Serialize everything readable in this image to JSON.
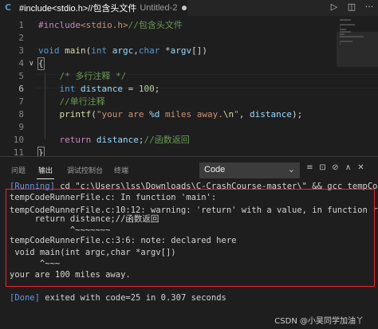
{
  "colors": {
    "background": "#1e1e1e",
    "keyword": "#569cd6",
    "string": "#ce9178",
    "comment": "#6a9955",
    "function": "#dcdcaa",
    "number": "#b5cea8",
    "running_tag": "#6796e6",
    "highlight_box": "#e8262b"
  },
  "tab": {
    "icon": "C",
    "icon_name": "c-language-icon",
    "title": "#include<stdio.h>//包含头文件",
    "subtitle": "Untitled-2",
    "dirty_indicator": "unsaved-dot-icon"
  },
  "editor_actions": [
    {
      "icon": "run-icon",
      "glyph": "▷"
    },
    {
      "icon": "split-editor-icon",
      "glyph": "◫"
    },
    {
      "icon": "more-icon",
      "glyph": "···"
    }
  ],
  "editor": {
    "lines": [
      {
        "n": "1",
        "tokens": [
          [
            "pp",
            "#include"
          ],
          [
            "str",
            "<stdio.h>"
          ],
          [
            "cmt",
            "//包含头文件"
          ]
        ]
      },
      {
        "n": "2",
        "tokens": []
      },
      {
        "n": "3",
        "tokens": [
          [
            "kw",
            "void"
          ],
          [
            "txt",
            " "
          ],
          [
            "fn",
            "main"
          ],
          [
            "txt",
            "("
          ],
          [
            "kw",
            "int"
          ],
          [
            "txt",
            " "
          ],
          [
            "var",
            "argc"
          ],
          [
            "txt",
            ","
          ],
          [
            "kw",
            "char"
          ],
          [
            "txt",
            " *"
          ],
          [
            "var",
            "argv"
          ],
          [
            "txt",
            "[])"
          ]
        ]
      },
      {
        "n": "4",
        "tokens": [
          [
            "txt",
            "{"
          ]
        ]
      },
      {
        "n": "5",
        "tokens": [
          [
            "cmt",
            "    /* 多行注释 */"
          ]
        ]
      },
      {
        "n": "6",
        "tokens": [
          [
            "txt",
            "    "
          ],
          [
            "kw",
            "int"
          ],
          [
            "txt",
            " "
          ],
          [
            "var",
            "distance"
          ],
          [
            "txt",
            " = "
          ],
          [
            "num",
            "100"
          ],
          [
            "txt",
            ";"
          ]
        ]
      },
      {
        "n": "7",
        "tokens": [
          [
            "cmt",
            "    //单行注释"
          ]
        ]
      },
      {
        "n": "8",
        "tokens": [
          [
            "txt",
            "    "
          ],
          [
            "fn",
            "printf"
          ],
          [
            "txt",
            "("
          ],
          [
            "str",
            "\"your are "
          ],
          [
            "var",
            "%d"
          ],
          [
            "str",
            " miles away."
          ],
          [
            "fn",
            "\\n"
          ],
          [
            "str",
            "\""
          ],
          [
            "txt",
            ", "
          ],
          [
            "var",
            "distance"
          ],
          [
            "txt",
            ");"
          ]
        ]
      },
      {
        "n": "9",
        "tokens": []
      },
      {
        "n": "10",
        "tokens": [
          [
            "txt",
            "    "
          ],
          [
            "pp",
            "return"
          ],
          [
            "txt",
            " "
          ],
          [
            "var",
            "distance"
          ],
          [
            "txt",
            ";"
          ],
          [
            "cmt",
            "//函数返回"
          ]
        ]
      },
      {
        "n": "11",
        "tokens": [
          [
            "txt",
            "}"
          ]
        ]
      }
    ],
    "active_line": "6"
  },
  "panel": {
    "tabs": [
      "问题",
      "输出",
      "调试控制台",
      "终端"
    ],
    "active_tab": "输出",
    "dropdown_value": "Code",
    "actions": [
      {
        "icon": "list-filter-icon",
        "glyph": "≡"
      },
      {
        "icon": "lock-icon",
        "glyph": "⊡"
      },
      {
        "icon": "clear-output-icon",
        "glyph": "⊘"
      },
      {
        "icon": "chevron-up-icon",
        "glyph": "∧"
      },
      {
        "icon": "close-icon",
        "glyph": "✕"
      }
    ]
  },
  "output": {
    "running_tag": "[Running]",
    "command": " cd \"c:\\Users\\lss\\Downloads\\C-CrashCourse-master\\\" && gcc tempCodeRunner",
    "lines": [
      "tempCodeRunnerFile.c: In function 'main':",
      "tempCodeRunnerFile.c:10:12: warning: 'return' with a value, in function returnin",
      "     return distance;//函数返回",
      "            ^~~~~~~~",
      "tempCodeRunnerFile.c:3:6: note: declared here",
      " void main(int argc,char *argv[])",
      "      ^~~~",
      "your are 100 miles away."
    ],
    "done_tag": "[Done]",
    "done_text": " exited with code=25 in 0.307 seconds"
  },
  "watermark": "CSDN @小昊同学加油丫"
}
